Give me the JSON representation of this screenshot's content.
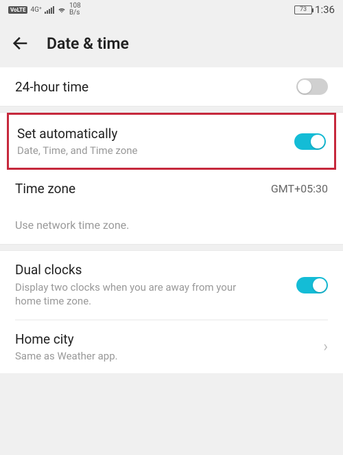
{
  "statusbar": {
    "volte": "VoLTE",
    "network": "4G⁺",
    "speed_top": "108",
    "speed_bot": "B/s",
    "battery": "73",
    "time": "1:36"
  },
  "header": {
    "title": "Date & time"
  },
  "rows": {
    "r24": {
      "title": "24-hour time"
    },
    "auto": {
      "title": "Set automatically",
      "sub": "Date, Time, and Time zone"
    },
    "tz": {
      "title": "Time zone",
      "value": "GMT+05:30"
    },
    "note": "Use network time zone.",
    "dual": {
      "title": "Dual clocks",
      "sub": "Display two clocks when you are away from your home time zone."
    },
    "home": {
      "title": "Home city",
      "sub": "Same as Weather app."
    }
  }
}
